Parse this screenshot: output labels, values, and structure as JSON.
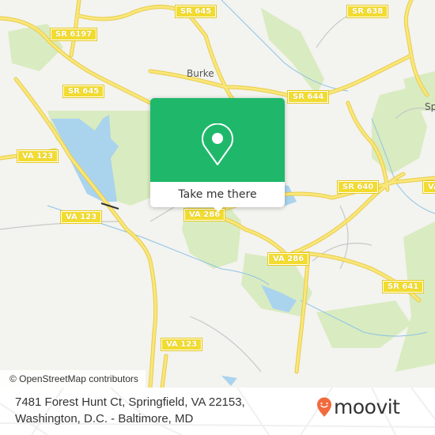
{
  "map": {
    "place_labels": [
      {
        "name": "Burke"
      },
      {
        "name": "Sp"
      }
    ],
    "road_shields": [
      {
        "label": "SR 645"
      },
      {
        "label": "SR 6197"
      },
      {
        "label": "SR 645"
      },
      {
        "label": "SR 638"
      },
      {
        "label": "SR 644"
      },
      {
        "label": "VA 123"
      },
      {
        "label": "VA 123"
      },
      {
        "label": "VA 286"
      },
      {
        "label": "SR 640"
      },
      {
        "label": "VA 286"
      },
      {
        "label": "SR 641"
      },
      {
        "label": "VA 123"
      },
      {
        "label": "VA"
      }
    ],
    "colors": {
      "background": "#f3f3ef",
      "park": "#d9ebc0",
      "water": "#aad3ee",
      "road_major": "#f7e36b",
      "road_minor": "#bdbdbd"
    }
  },
  "popup": {
    "icon": "location-pin-icon",
    "button_label": "Take me there",
    "accent_color": "#1fb86b"
  },
  "attribution": {
    "text": "© OpenStreetMap contributors"
  },
  "footer": {
    "address_line1": "7481 Forest Hunt Ct, Springfield, VA 22153,",
    "address_line2": "Washington, D.C. - Baltimore, MD",
    "logo": {
      "icon": "moovit-pin-icon",
      "text": "moovit",
      "brand_color": "#f26a3d"
    }
  }
}
